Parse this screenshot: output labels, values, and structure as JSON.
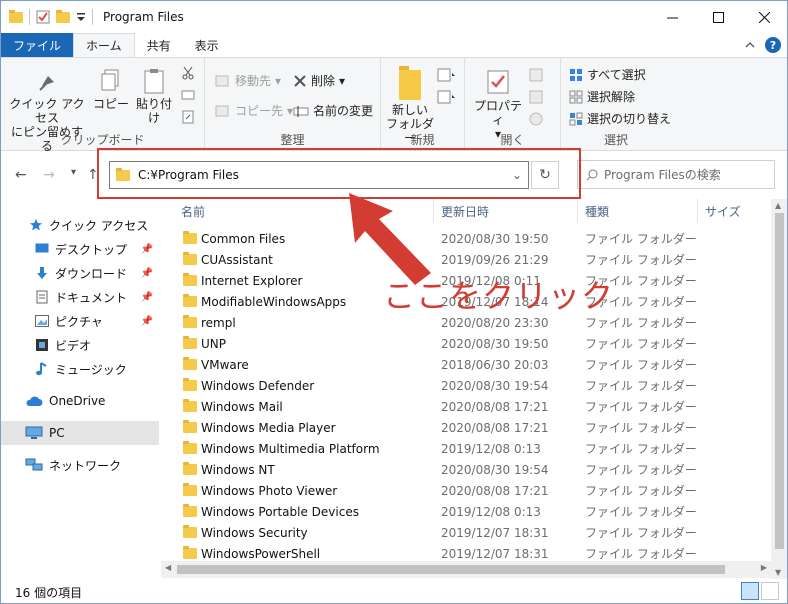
{
  "window": {
    "title": "Program Files"
  },
  "tabs": [
    {
      "label": "ファイル"
    },
    {
      "label": "ホーム"
    },
    {
      "label": "共有"
    },
    {
      "label": "表示"
    }
  ],
  "ribbon": {
    "clipboard": {
      "group_title": "クリップボード",
      "pin_quick_line1": "クイック アクセス",
      "pin_quick_line2": "にピン留めする",
      "copy": "コピー",
      "paste": "貼り付け"
    },
    "organize": {
      "group_title": "整理",
      "move_to": "移動先",
      "copy_to": "コピー先",
      "delete": "削除",
      "rename": "名前の変更"
    },
    "new": {
      "group_title": "新規",
      "new_folder_line1": "新しい",
      "new_folder_line2": "フォルダー"
    },
    "open": {
      "group_title": "開く",
      "properties": "プロパティ"
    },
    "select": {
      "group_title": "選択",
      "select_all": "すべて選択",
      "select_none": "選択解除",
      "invert": "選択の切り替え"
    }
  },
  "address": {
    "path": "C:¥Program Files",
    "search_placeholder": "Program Filesの検索"
  },
  "sidebar": {
    "items": [
      {
        "label": "クイック アクセス",
        "icon": "star-icon"
      },
      {
        "label": "デスクトップ",
        "icon": "desktop-icon",
        "pinned": true
      },
      {
        "label": "ダウンロード",
        "icon": "download-icon",
        "pinned": true
      },
      {
        "label": "ドキュメント",
        "icon": "document-icon",
        "pinned": true
      },
      {
        "label": "ピクチャ",
        "icon": "picture-icon",
        "pinned": true
      },
      {
        "label": "ビデオ",
        "icon": "video-icon"
      },
      {
        "label": "ミュージック",
        "icon": "music-icon"
      },
      {
        "label": "OneDrive",
        "icon": "cloud-icon"
      },
      {
        "label": "PC",
        "icon": "pc-icon",
        "selected": true
      },
      {
        "label": "ネットワーク",
        "icon": "network-icon"
      }
    ]
  },
  "columns": {
    "name": "名前",
    "date": "更新日時",
    "type": "種類",
    "size": "サイズ"
  },
  "files": [
    {
      "name": "Common Files",
      "date": "2020/08/30 19:50",
      "type": "ファイル フォルダー"
    },
    {
      "name": "CUAssistant",
      "date": "2019/09/26 21:29",
      "type": "ファイル フォルダー"
    },
    {
      "name": "Internet Explorer",
      "date": "2019/12/08 0:11",
      "type": "ファイル フォルダー"
    },
    {
      "name": "ModifiableWindowsApps",
      "date": "2019/12/07 18:14",
      "type": "ファイル フォルダー"
    },
    {
      "name": "rempl",
      "date": "2020/08/20 23:30",
      "type": "ファイル フォルダー"
    },
    {
      "name": "UNP",
      "date": "2020/08/30 19:50",
      "type": "ファイル フォルダー"
    },
    {
      "name": "VMware",
      "date": "2018/06/30 20:03",
      "type": "ファイル フォルダー"
    },
    {
      "name": "Windows Defender",
      "date": "2020/08/30 19:54",
      "type": "ファイル フォルダー"
    },
    {
      "name": "Windows Mail",
      "date": "2020/08/08 17:21",
      "type": "ファイル フォルダー"
    },
    {
      "name": "Windows Media Player",
      "date": "2020/08/08 17:21",
      "type": "ファイル フォルダー"
    },
    {
      "name": "Windows Multimedia Platform",
      "date": "2019/12/08 0:13",
      "type": "ファイル フォルダー"
    },
    {
      "name": "Windows NT",
      "date": "2020/08/30 19:54",
      "type": "ファイル フォルダー"
    },
    {
      "name": "Windows Photo Viewer",
      "date": "2020/08/08 17:21",
      "type": "ファイル フォルダー"
    },
    {
      "name": "Windows Portable Devices",
      "date": "2019/12/08 0:13",
      "type": "ファイル フォルダー"
    },
    {
      "name": "Windows Security",
      "date": "2019/12/07 18:31",
      "type": "ファイル フォルダー"
    },
    {
      "name": "WindowsPowerShell",
      "date": "2019/12/07 18:31",
      "type": "ファイル フォルダー"
    }
  ],
  "status": {
    "count": "16 個の項目"
  },
  "annotation": {
    "text": "ここをクリック",
    "color": "#d23c33"
  }
}
